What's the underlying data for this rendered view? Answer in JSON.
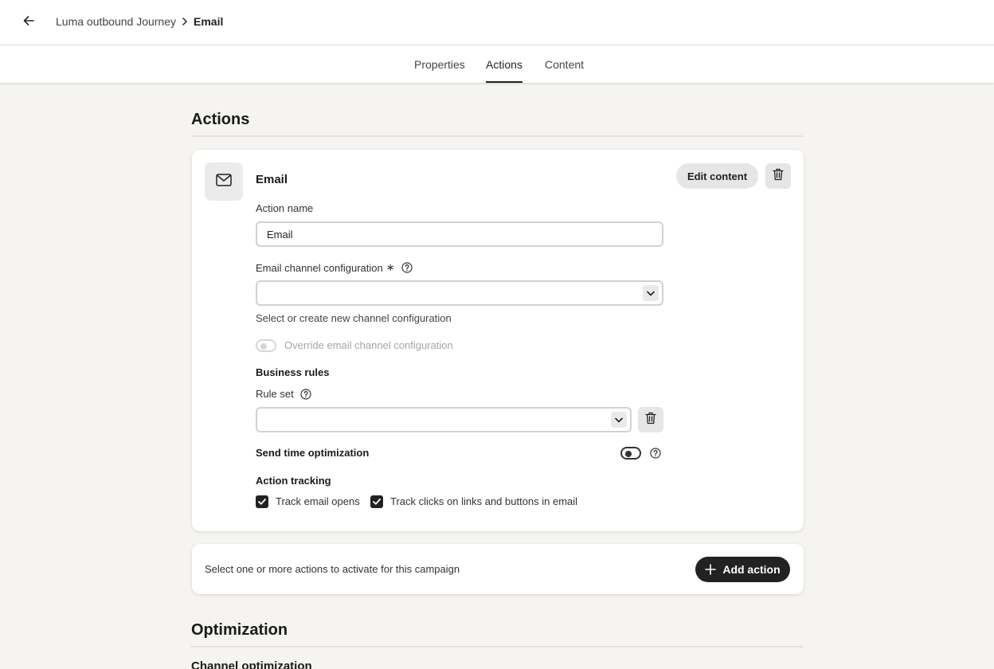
{
  "header": {
    "breadcrumb_parent": "Luma outbound Journey",
    "breadcrumb_current": "Email"
  },
  "tabs": [
    {
      "label": "Properties",
      "active": false
    },
    {
      "label": "Actions",
      "active": true
    },
    {
      "label": "Content",
      "active": false
    }
  ],
  "actions_section": {
    "title": "Actions",
    "card": {
      "heading": "Email",
      "edit_content_label": "Edit content",
      "action_name_label": "Action name",
      "action_name_value": "Email",
      "channel_config_label": "Email channel configuration",
      "required_mark": "∗",
      "channel_config_value": "",
      "channel_config_helper": "Select or create new channel configuration",
      "override_toggle_label": "Override email channel configuration",
      "business_rules_title": "Business rules",
      "rule_set_label": "Rule set",
      "rule_set_value": "",
      "send_time_label": "Send time optimization",
      "action_tracking_title": "Action tracking",
      "track_opens_label": "Track email opens",
      "track_clicks_label": "Track clicks on links and buttons in email"
    },
    "add_action": {
      "text": "Select one or more actions to activate for this campaign",
      "button_label": "Add action"
    }
  },
  "optimization_section": {
    "title": "Optimization",
    "subtitle": "Channel optimization"
  },
  "icons": {
    "back": "arrow-left-icon",
    "breadcrumb_separator": "chevron-right-icon",
    "email": "mail-icon",
    "delete": "trash-icon",
    "help": "help-circle-icon",
    "dropdown": "chevron-down-icon",
    "check": "checkmark-icon",
    "add": "plus-icon"
  },
  "colors": {
    "page_background": "#f5f4f1",
    "primary_button": "#222222",
    "secondary_button": "#e6e6e6"
  }
}
